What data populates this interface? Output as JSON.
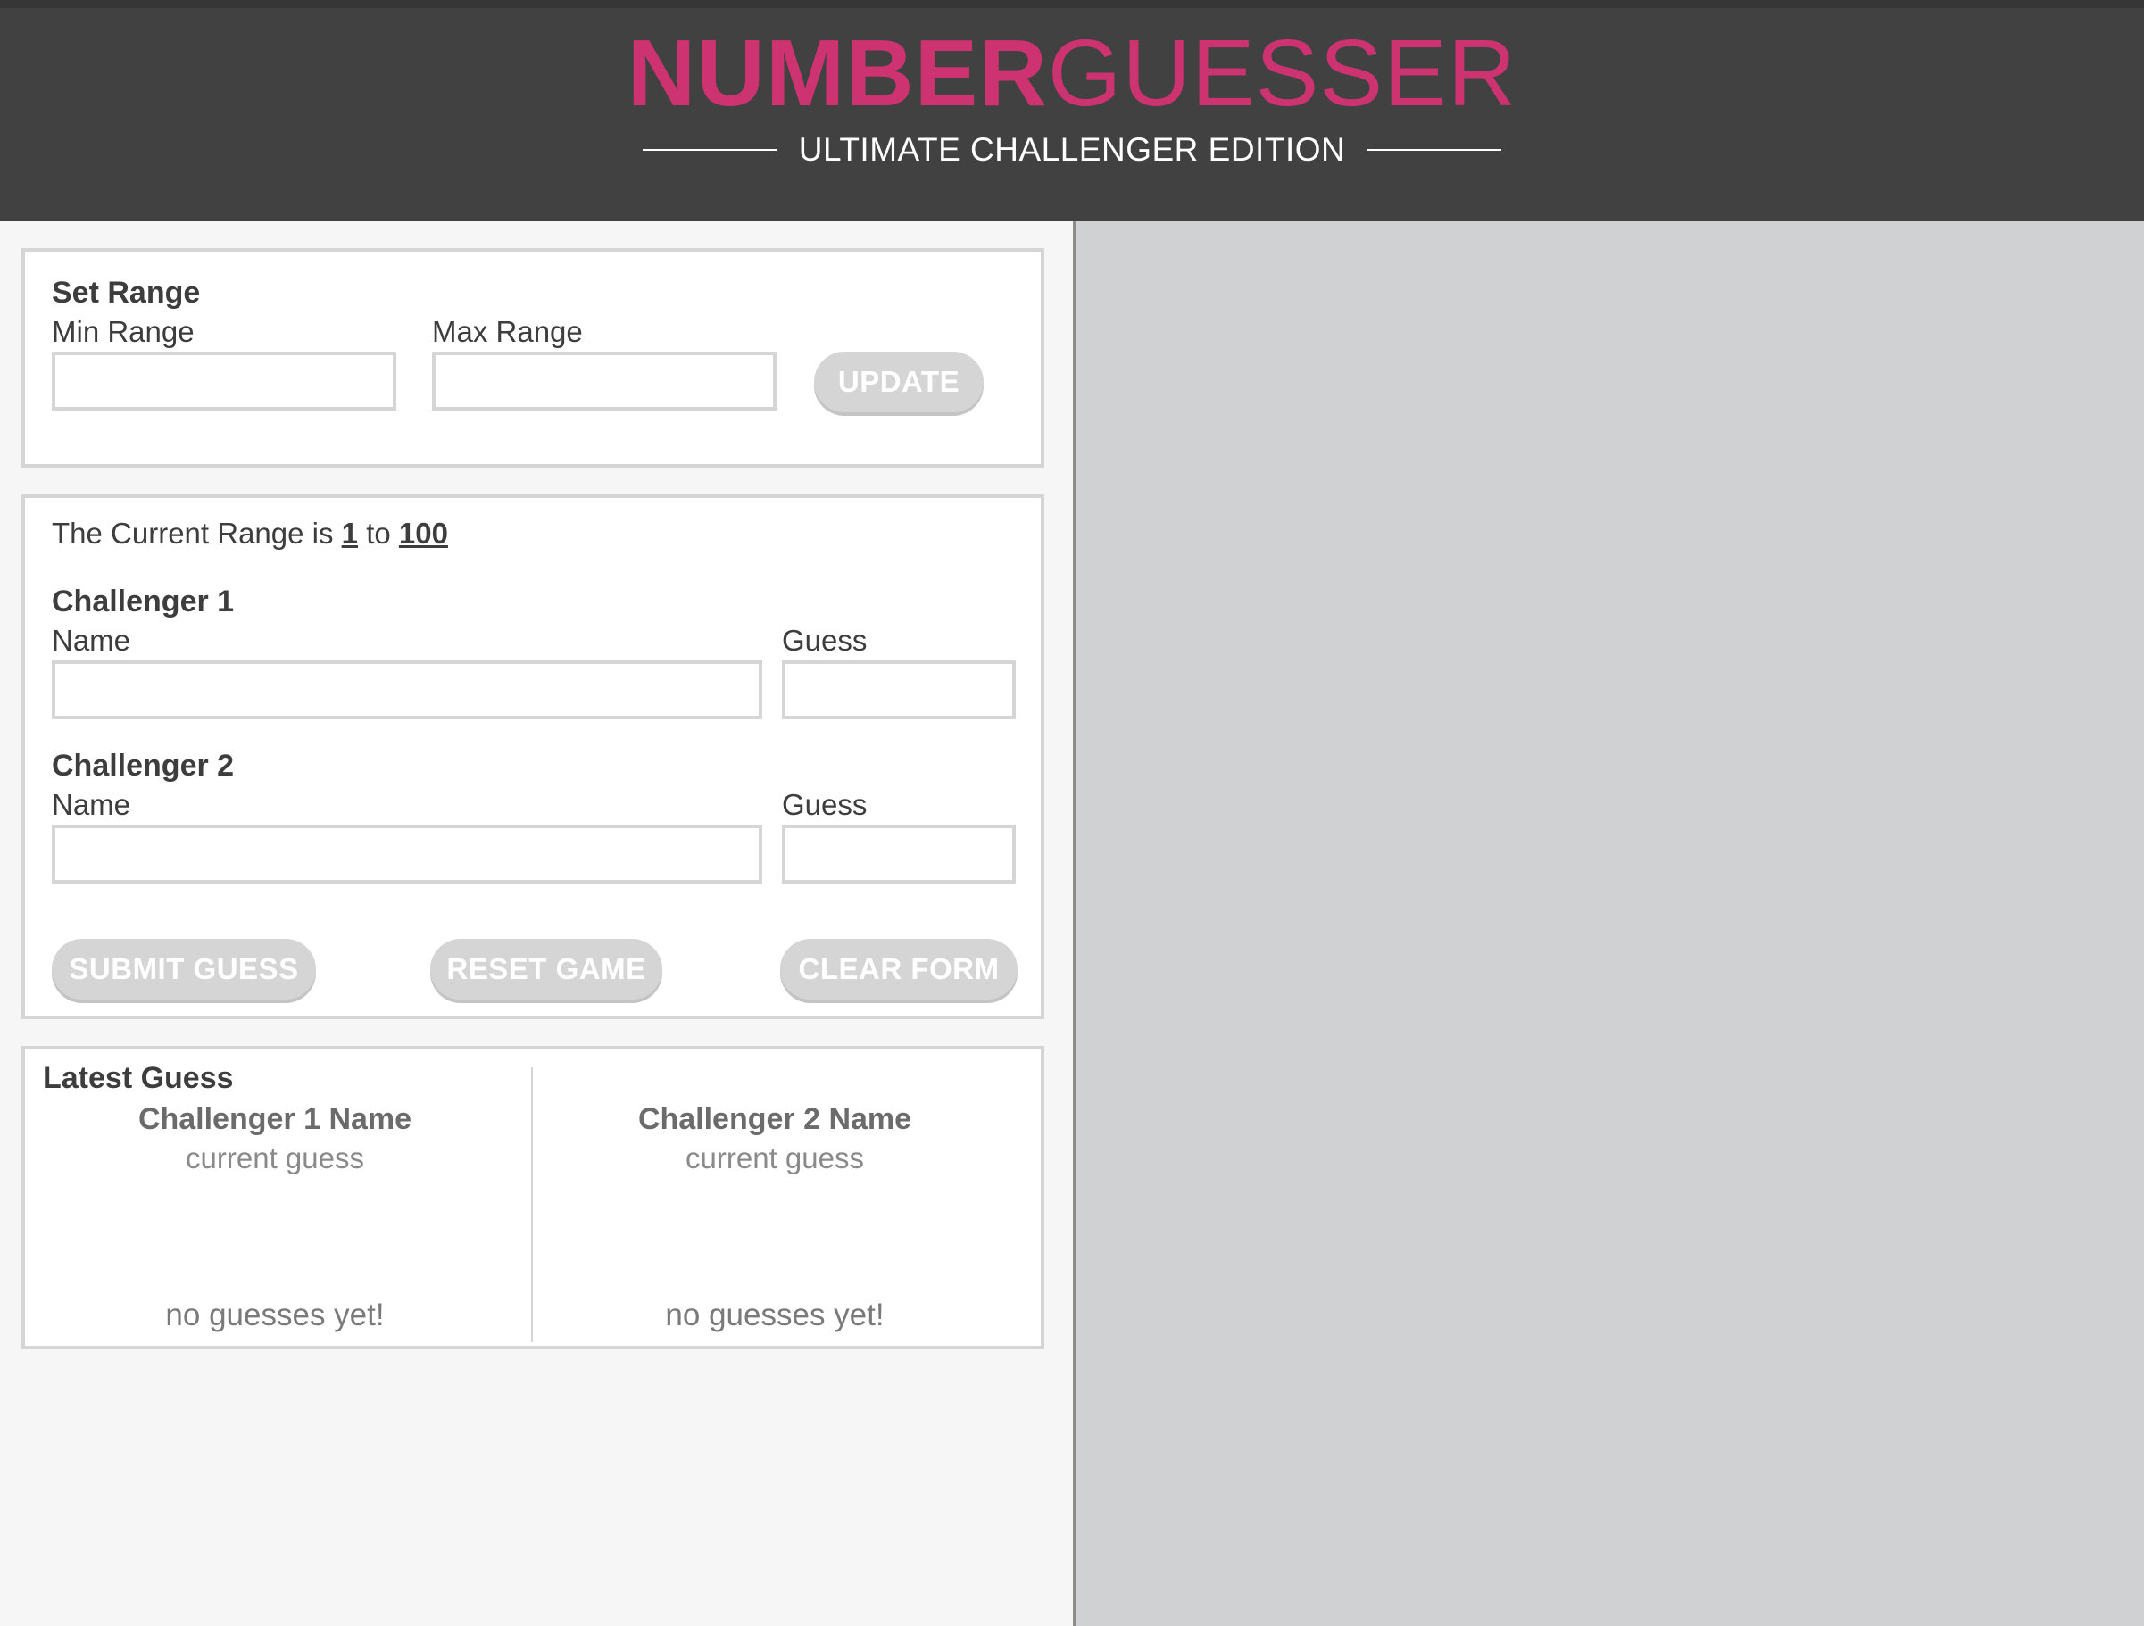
{
  "header": {
    "title_bold": "NUMBER",
    "title_light": "GUESSER",
    "subtitle": "ULTIMATE CHALLENGER EDITION"
  },
  "set_range": {
    "heading": "Set Range",
    "min_label": "Min Range",
    "min_value": "",
    "max_label": "Max Range",
    "max_value": "",
    "update_button": "UPDATE"
  },
  "current_range": {
    "prefix": "The Current Range is",
    "min": "1",
    "joiner": "to",
    "max": "100"
  },
  "challenger1": {
    "heading": "Challenger 1",
    "name_label": "Name",
    "name_value": "",
    "guess_label": "Guess",
    "guess_value": ""
  },
  "challenger2": {
    "heading": "Challenger 2",
    "name_label": "Name",
    "name_value": "",
    "guess_label": "Guess",
    "guess_value": ""
  },
  "actions": {
    "submit": "SUBMIT GUESS",
    "reset": "RESET GAME",
    "clear": "CLEAR FORM"
  },
  "latest_guess": {
    "heading": "Latest Guess",
    "c1_name": "Challenger 1 Name",
    "c1_guess": "current guess",
    "c1_status": "no guesses yet!",
    "c2_name": "Challenger 2 Name",
    "c2_guess": "current guess",
    "c2_status": "no guesses yet!"
  },
  "colors": {
    "accent": "#cd3370",
    "header_bg": "#414141",
    "right_pane_bg": "#d0d1d3",
    "button_disabled": "#d5d5d5"
  }
}
